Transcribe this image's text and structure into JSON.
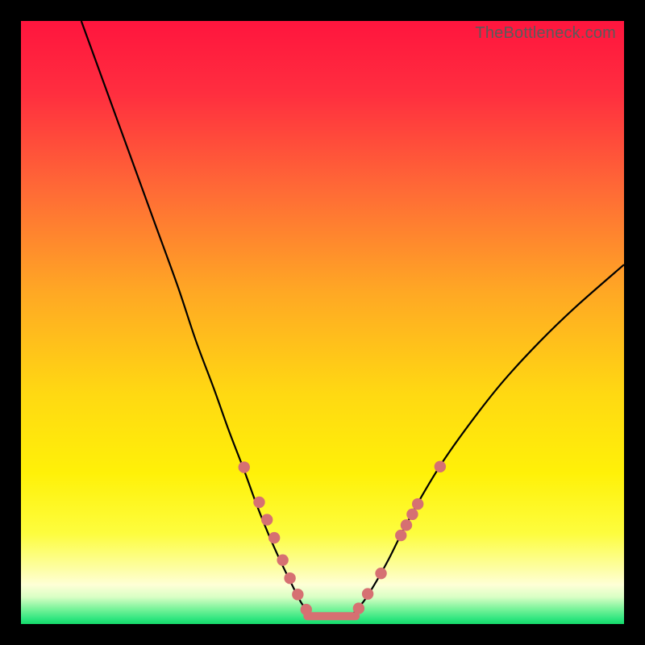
{
  "watermark": "TheBottleneck.com",
  "colors": {
    "background": "#000000",
    "curve": "#000000",
    "dots": "#d67072",
    "gradient_stops": [
      {
        "offset": 0.0,
        "color": "#ff153e"
      },
      {
        "offset": 0.12,
        "color": "#ff2e3f"
      },
      {
        "offset": 0.28,
        "color": "#ff6a36"
      },
      {
        "offset": 0.45,
        "color": "#ffa824"
      },
      {
        "offset": 0.62,
        "color": "#ffd912"
      },
      {
        "offset": 0.75,
        "color": "#fff108"
      },
      {
        "offset": 0.85,
        "color": "#fdfd3e"
      },
      {
        "offset": 0.905,
        "color": "#fdfe9e"
      },
      {
        "offset": 0.935,
        "color": "#feffd6"
      },
      {
        "offset": 0.955,
        "color": "#d9ffc5"
      },
      {
        "offset": 0.975,
        "color": "#79f39a"
      },
      {
        "offset": 0.992,
        "color": "#2de57e"
      },
      {
        "offset": 1.0,
        "color": "#15d969"
      }
    ]
  },
  "chart_data": {
    "type": "line",
    "title": "",
    "xlabel": "",
    "ylabel": "",
    "xlim": [
      0,
      100
    ],
    "ylim": [
      0,
      100
    ],
    "series": [
      {
        "name": "left-curve",
        "x": [
          10,
          14,
          18,
          22,
          26,
          29,
          32,
          34.5,
          37,
          39,
          41,
          43,
          44.8,
          46.5,
          48
        ],
        "y": [
          100,
          89,
          78,
          67,
          56,
          47,
          39,
          32,
          25.5,
          20,
          15,
          10.5,
          6.8,
          3.5,
          1.6
        ]
      },
      {
        "name": "right-curve",
        "x": [
          55,
          57,
          59,
          61,
          63,
          66,
          70,
          75,
          80,
          86,
          92,
          100
        ],
        "y": [
          1.6,
          4.0,
          7.2,
          10.8,
          14.8,
          20.4,
          27.0,
          34.0,
          40.3,
          46.8,
          52.6,
          59.6
        ]
      },
      {
        "name": "valley-floor",
        "x": [
          47.5,
          55.5
        ],
        "y": [
          1.3,
          1.3
        ]
      }
    ],
    "points": [
      {
        "name": "left-arm-dots",
        "data": [
          {
            "x": 37.0,
            "y": 26.0
          },
          {
            "x": 39.5,
            "y": 20.2
          },
          {
            "x": 40.8,
            "y": 17.3
          },
          {
            "x": 42.0,
            "y": 14.3
          },
          {
            "x": 43.4,
            "y": 10.6
          },
          {
            "x": 44.6,
            "y": 7.6
          },
          {
            "x": 45.9,
            "y": 4.9
          },
          {
            "x": 47.3,
            "y": 2.4
          }
        ]
      },
      {
        "name": "right-arm-dots",
        "data": [
          {
            "x": 56.0,
            "y": 2.6
          },
          {
            "x": 57.5,
            "y": 5.0
          },
          {
            "x": 59.7,
            "y": 8.4
          },
          {
            "x": 63.0,
            "y": 14.7
          },
          {
            "x": 63.9,
            "y": 16.4
          },
          {
            "x": 64.9,
            "y": 18.2
          },
          {
            "x": 65.8,
            "y": 19.9
          },
          {
            "x": 69.5,
            "y": 26.1
          }
        ]
      }
    ]
  }
}
